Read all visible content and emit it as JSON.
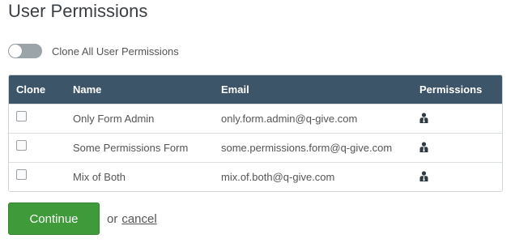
{
  "page": {
    "title": "User Permissions"
  },
  "clone_all": {
    "label": "Clone All User Permissions",
    "enabled": false
  },
  "table": {
    "headers": {
      "clone": "Clone",
      "name": "Name",
      "email": "Email",
      "permissions": "Permissions"
    },
    "rows": [
      {
        "name": "Only Form Admin",
        "email": "only.form.admin@q-give.com",
        "checked": false,
        "permissions_icon": "user-tie-icon"
      },
      {
        "name": "Some Permissions Form",
        "email": "some.permissions.form@q-give.com",
        "checked": false,
        "permissions_icon": "user-tie-icon"
      },
      {
        "name": "Mix of Both",
        "email": "mix.of.both@q-give.com",
        "checked": false,
        "permissions_icon": "user-tie-icon"
      }
    ]
  },
  "actions": {
    "continue_label": "Continue",
    "or_text": "or",
    "cancel_label": "cancel"
  },
  "colors": {
    "header_bg": "#3d5568",
    "primary_button": "#3f9a3a",
    "toggle_off": "#9ba4a8"
  }
}
